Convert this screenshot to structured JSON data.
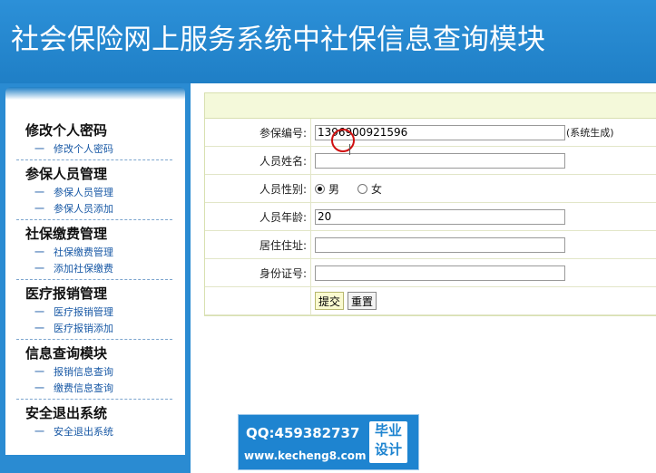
{
  "header": {
    "title": "社会保险网上服务系统中社保信息查询模块"
  },
  "sidebar": {
    "groups": [
      {
        "title": "修改个人密码",
        "items": [
          "修改个人密码"
        ]
      },
      {
        "title": "参保人员管理",
        "items": [
          "参保人员管理",
          "参保人员添加"
        ]
      },
      {
        "title": "社保缴费管理",
        "items": [
          "社保缴费管理",
          "添加社保缴费"
        ]
      },
      {
        "title": "医疗报销管理",
        "items": [
          "医疗报销管理",
          "医疗报销添加"
        ]
      },
      {
        "title": "信息查询模块",
        "items": [
          "报销信息查询",
          "缴费信息查询"
        ]
      },
      {
        "title": "安全退出系统",
        "items": [
          "安全退出系统"
        ]
      }
    ],
    "dash": "一"
  },
  "form": {
    "insure_no": {
      "label": "参保编号:",
      "value": "1396900921596",
      "hint": "(系统生成)"
    },
    "name": {
      "label": "人员姓名:",
      "value": ""
    },
    "gender": {
      "label": "人员性别:",
      "options": [
        "男",
        "女"
      ],
      "selected": "男"
    },
    "age": {
      "label": "人员年龄:",
      "value": "20"
    },
    "address": {
      "label": "居住住址:",
      "value": ""
    },
    "id_no": {
      "label": "身份证号:",
      "value": ""
    },
    "submit_label": "提交",
    "reset_label": "重置"
  },
  "watermark": {
    "qq": "QQ:459382737",
    "url": "www.kecheng8.com",
    "badge_line1": "毕业",
    "badge_line2": "设计"
  }
}
